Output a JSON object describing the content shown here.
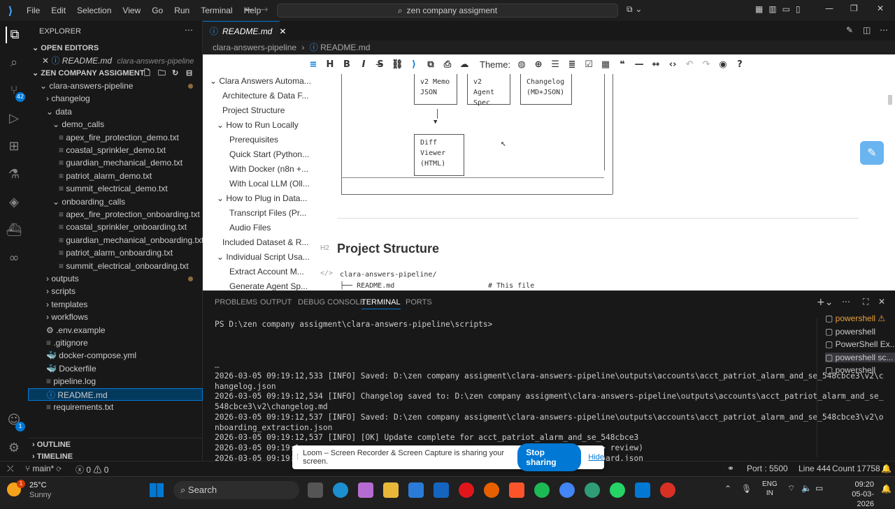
{
  "menu": [
    "File",
    "Edit",
    "Selection",
    "View",
    "Go",
    "Run",
    "Terminal",
    "Help"
  ],
  "search": {
    "text": "zen company assigment"
  },
  "sidebar": {
    "title": "EXPLORER",
    "open_editors": "OPEN EDITORS",
    "open_file": "README.md",
    "open_file_folder": "clara-answers-pipeline",
    "workspace": "ZEN COMPANY ASSIGMENT",
    "tree": [
      {
        "label": "clara-answers-pipeline",
        "indent": 1,
        "icon": "chevron-down-icon",
        "dot": true
      },
      {
        "label": "changelog",
        "indent": 2,
        "icon": "chevron-right-icon"
      },
      {
        "label": "data",
        "indent": 2,
        "icon": "chevron-down-icon"
      },
      {
        "label": "demo_calls",
        "indent": 3,
        "icon": "chevron-down-icon"
      },
      {
        "label": "apex_fire_protection_demo.txt",
        "indent": 4,
        "icon": "file-icon"
      },
      {
        "label": "coastal_sprinkler_demo.txt",
        "indent": 4,
        "icon": "file-icon"
      },
      {
        "label": "guardian_mechanical_demo.txt",
        "indent": 4,
        "icon": "file-icon"
      },
      {
        "label": "patriot_alarm_demo.txt",
        "indent": 4,
        "icon": "file-icon"
      },
      {
        "label": "summit_electrical_demo.txt",
        "indent": 4,
        "icon": "file-icon"
      },
      {
        "label": "onboarding_calls",
        "indent": 3,
        "icon": "chevron-down-icon"
      },
      {
        "label": "apex_fire_protection_onboarding.txt",
        "indent": 4,
        "icon": "file-icon"
      },
      {
        "label": "coastal_sprinkler_onboarding.txt",
        "indent": 4,
        "icon": "file-icon"
      },
      {
        "label": "guardian_mechanical_onboarding.txt",
        "indent": 4,
        "icon": "file-icon"
      },
      {
        "label": "patriot_alarm_onboarding.txt",
        "indent": 4,
        "icon": "file-icon"
      },
      {
        "label": "summit_electrical_onboarding.txt",
        "indent": 4,
        "icon": "file-icon"
      },
      {
        "label": "outputs",
        "indent": 2,
        "icon": "chevron-right-icon",
        "dot": true
      },
      {
        "label": "scripts",
        "indent": 2,
        "icon": "chevron-right-icon"
      },
      {
        "label": "templates",
        "indent": 2,
        "icon": "chevron-right-icon"
      },
      {
        "label": "workflows",
        "indent": 2,
        "icon": "chevron-right-icon"
      },
      {
        "label": ".env.example",
        "indent": 2,
        "icon": "gear-icon"
      },
      {
        "label": ".gitignore",
        "indent": 2,
        "icon": "file-icon"
      },
      {
        "label": "docker-compose.yml",
        "indent": 2,
        "icon": "docker-icon"
      },
      {
        "label": "Dockerfile",
        "indent": 2,
        "icon": "docker-icon"
      },
      {
        "label": "pipeline.log",
        "indent": 2,
        "icon": "file-icon"
      },
      {
        "label": "README.md",
        "indent": 2,
        "icon": "info-icon",
        "selected": true
      },
      {
        "label": "requirements.txt",
        "indent": 2,
        "icon": "file-icon"
      }
    ],
    "outline": "OUTLINE",
    "timeline": "TIMELINE",
    "badge_source": "42",
    "badge_account": "1"
  },
  "editor": {
    "tab": "README.md",
    "breadcrumb_folder": "clara-answers-pipeline",
    "breadcrumb_file": "README.md",
    "theme_label": "Theme:",
    "toc": [
      {
        "label": "Clara Answers Automa...",
        "indent": 1,
        "chev": "chevron-down-icon"
      },
      {
        "label": "Architecture & Data F...",
        "indent": 2
      },
      {
        "label": "Project Structure",
        "indent": 2
      },
      {
        "label": "How to Run Locally",
        "indent": 2,
        "chev": "chevron-down-icon"
      },
      {
        "label": "Prerequisites",
        "indent": 3
      },
      {
        "label": "Quick Start (Python...",
        "indent": 3
      },
      {
        "label": "With Docker (n8n +...",
        "indent": 3
      },
      {
        "label": "With Local LLM (Oll...",
        "indent": 3
      },
      {
        "label": "How to Plug in Data...",
        "indent": 2,
        "chev": "chevron-down-icon"
      },
      {
        "label": "Transcript Files (Pr...",
        "indent": 3
      },
      {
        "label": "Audio Files",
        "indent": 3
      },
      {
        "label": "Included Dataset & R...",
        "indent": 2
      },
      {
        "label": "Individual Script Usa...",
        "indent": 2,
        "chev": "chevron-down-icon"
      },
      {
        "label": "Extract Account M...",
        "indent": 3
      },
      {
        "label": "Generate Agent Sp...",
        "indent": 3
      }
    ],
    "boxes": [
      {
        "l1": "v2 Memo",
        "l2": "JSON"
      },
      {
        "l1": "v2 Agent",
        "l2": "Spec"
      },
      {
        "l1": "Changelog",
        "l2": "(MD+JSON)"
      }
    ],
    "diff_box": [
      "Diff",
      "Viewer",
      "(HTML)"
    ],
    "arrow": "▼",
    "h2_tag": "H2",
    "heading": "Project Structure",
    "code_tag": "</>",
    "code_line1": "clara-answers-pipeline/",
    "code_line2": "├── README.md",
    "code_line2_comment": "# This file"
  },
  "panel": {
    "tabs": [
      "PROBLEMS",
      "OUTPUT",
      "DEBUG CONSOLE",
      "TERMINAL",
      "PORTS"
    ],
    "active_tab": "TERMINAL",
    "prompt": "PS D:\\zen company assigment\\clara-answers-pipeline\\scripts>",
    "log": [
      "2026-03-05 09:19:12,533 [INFO] Saved: D:\\zen company assigment\\clara-answers-pipeline\\outputs\\accounts\\acct_patriot_alarm_and_se_548cbce3\\v2\\c",
      "hangelog.json",
      "2026-03-05 09:19:12,534 [INFO] Changelog saved to: D:\\zen company assigment\\clara-answers-pipeline\\outputs\\accounts\\acct_patriot_alarm_and_se_",
      "548cbce3\\v2\\changelog.md",
      "2026-03-05 09:19:12,537 [INFO] Saved: D:\\zen company assigment\\clara-answers-pipeline\\outputs\\accounts\\acct_patriot_alarm_and_se_548cbce3\\v2\\o",
      "nboarding_extraction.json",
      "2026-03-05 09:19:12,537 [INFO] [OK] Update complete for acct_patriot_alarm_and_se_548cbce3",
      "2026-03-05 09:19:1                                                         gress -> review)",
      "2026-03-05 09:19:1                                                         \\task_board.json"
    ],
    "terminals": [
      "powershell",
      "powershell",
      "PowerShell Ex...",
      "powershell sc...",
      "powershell"
    ]
  },
  "loom": {
    "message": "Loom – Screen Recorder & Screen Capture is sharing your screen.",
    "stop": "Stop sharing",
    "hide": "Hide"
  },
  "status": {
    "branch": "main*",
    "errors": "0",
    "warnings": "0",
    "port": "Port : 5500",
    "line": "Line 444",
    "count": "Count 17758"
  },
  "taskbar": {
    "temp": "25°C",
    "weather": "Sunny",
    "search": "Search",
    "lang1": "ENG",
    "lang2": "IN",
    "time": "09:20",
    "date": "05-03-2026"
  },
  "colors": {
    "accent": "#0078d4",
    "loom": "#4a4af5"
  }
}
